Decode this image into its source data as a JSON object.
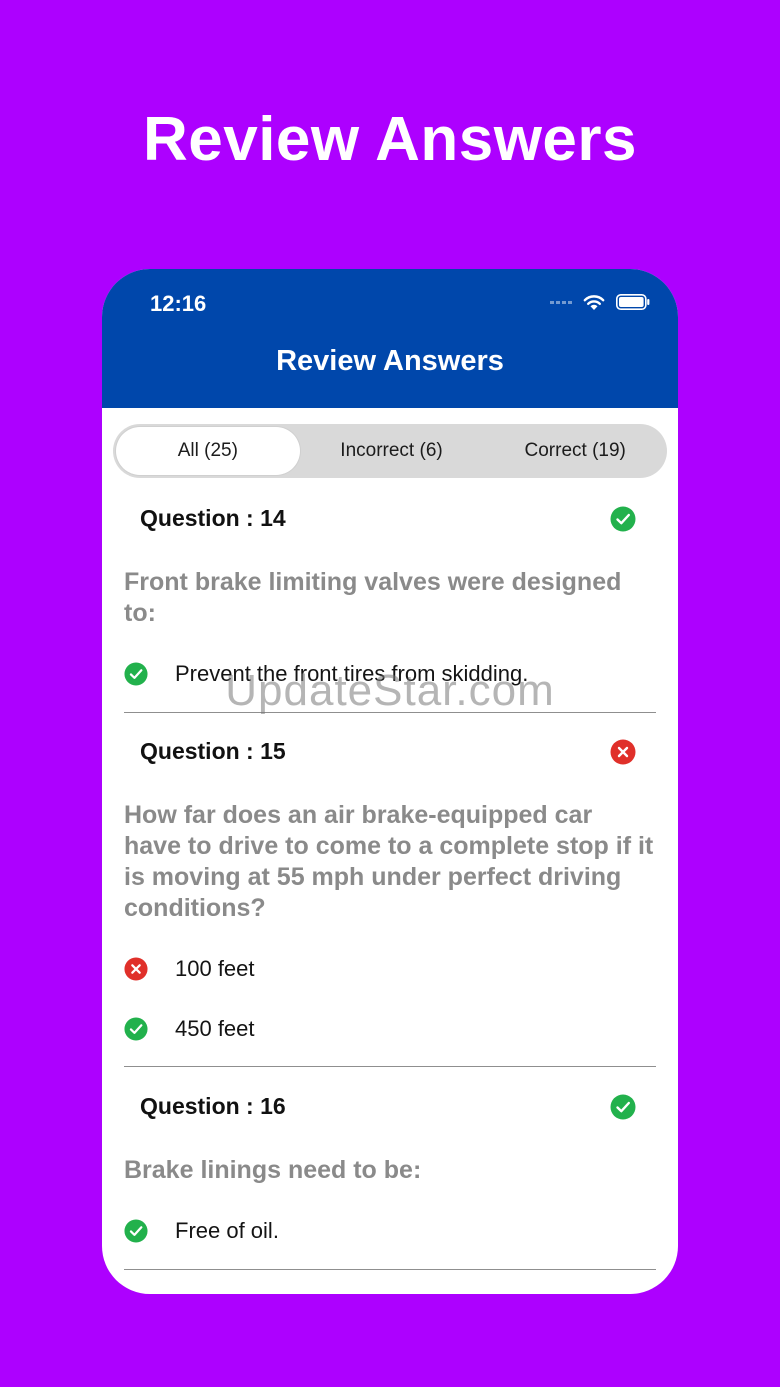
{
  "promo": {
    "title": "Review Answers"
  },
  "status_bar": {
    "time": "12:16"
  },
  "header": {
    "title": "Review Answers"
  },
  "tabs": [
    {
      "label": "All (25)",
      "active": true
    },
    {
      "label": "Incorrect (6)",
      "active": false
    },
    {
      "label": "Correct (19)",
      "active": false
    }
  ],
  "questions": [
    {
      "label": "Question : 14",
      "status": "correct",
      "text": "Front brake limiting valves were designed to:",
      "answers": [
        {
          "text": "Prevent the front tires from skidding.",
          "status": "correct"
        }
      ]
    },
    {
      "label": "Question : 15",
      "status": "incorrect",
      "text": "How far does an air brake-equipped car have to drive to come to a complete stop if it is moving at 55 mph under perfect driving conditions?",
      "answers": [
        {
          "text": "100 feet",
          "status": "incorrect"
        },
        {
          "text": "450 feet",
          "status": "correct"
        }
      ]
    },
    {
      "label": "Question : 16",
      "status": "correct",
      "text": "Brake linings need to be:",
      "answers": [
        {
          "text": "Free of oil.",
          "status": "correct"
        }
      ]
    }
  ],
  "watermark": "UpdateStar.com",
  "colors": {
    "background": "#ad00ff",
    "header": "#0047ab",
    "correct": "#22b14c",
    "incorrect": "#e0302a"
  }
}
